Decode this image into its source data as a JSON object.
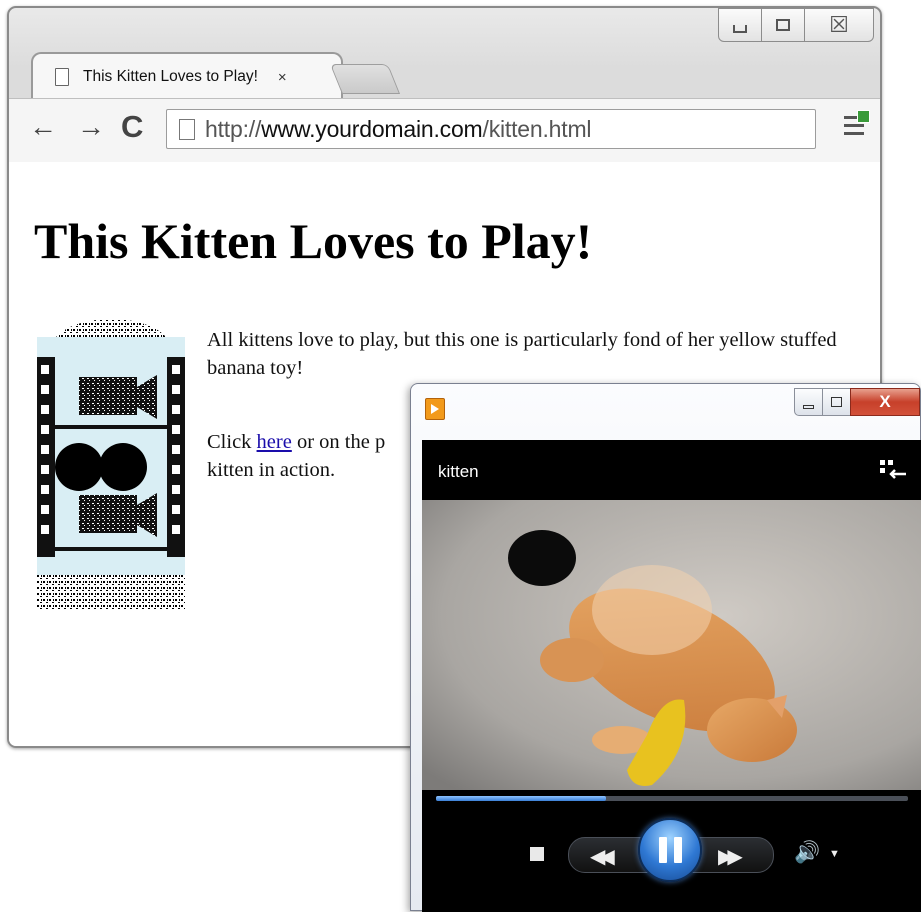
{
  "browser": {
    "tab": {
      "title": "This Kitten Loves to Play!",
      "close": "×"
    },
    "nav": {
      "back": "←",
      "forward": "→",
      "reload": "C"
    },
    "address": {
      "scheme": "http://",
      "host": "www.yourdomain.com",
      "path": "/kitten.html"
    },
    "window_controls": {
      "close": "☒"
    }
  },
  "page": {
    "heading": "This Kitten Loves to Play!",
    "para1": "All kittens love to play, but this one is particularly fond of her yellow stuffed banana toy!",
    "para2_before": "Click ",
    "para2_link": "here",
    "para2_mid": " or on the p",
    "para2_end": "kitten in action."
  },
  "player": {
    "title": "kitten",
    "close": "X",
    "progress": 0.36,
    "controls": {
      "rewind": "◀◀",
      "fast_forward": "▶▶",
      "volume": "🔊",
      "volume_menu": "▼"
    }
  },
  "colors": {
    "link": "#1a0dab",
    "progress_fill": "#3b7fd6",
    "close_button": "#c7402a"
  }
}
